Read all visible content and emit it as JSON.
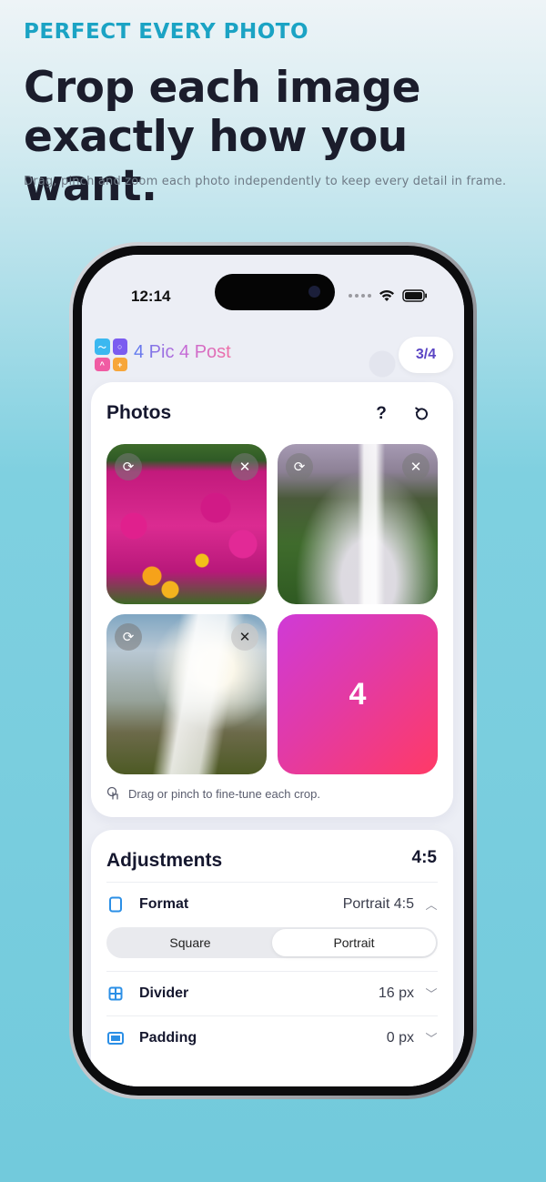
{
  "hero": {
    "eyebrow": "PERFECT EVERY PHOTO",
    "title_line1": "Crop each image",
    "title_line2": "exactly how you want.",
    "subtitle": "Drag, pinch and zoom each photo independently to keep every detail in frame."
  },
  "status_bar": {
    "time": "12:14",
    "icons": [
      "signal-dots-icon",
      "wifi-icon",
      "battery-icon"
    ]
  },
  "app_bar": {
    "app_name": "4 Pic 4 Post",
    "counter": "3/4"
  },
  "photos": {
    "title": "Photos",
    "help_icon_glyph": "?",
    "tiles": [
      {
        "kind": "photo",
        "subject": "flowers",
        "actions": [
          "rotate-icon",
          "remove-icon"
        ]
      },
      {
        "kind": "photo",
        "subject": "waterfall",
        "actions": [
          "rotate-icon",
          "remove-icon"
        ]
      },
      {
        "kind": "photo",
        "subject": "waterfall",
        "actions": [
          "rotate-icon",
          "remove-icon"
        ]
      },
      {
        "kind": "add",
        "label": "4"
      }
    ],
    "hint": "Drag or pinch to fine-tune each crop."
  },
  "adjustments": {
    "title": "Adjustments",
    "ratio": "4:5",
    "format": {
      "label": "Format",
      "value": "Portrait 4:5",
      "expanded": true
    },
    "segments": [
      "Square",
      "Portrait"
    ],
    "selected_segment": "Portrait",
    "divider": {
      "label": "Divider",
      "value": "16 px"
    },
    "padding": {
      "label": "Padding",
      "value": "0 px"
    }
  },
  "colors": {
    "accent_teal": "#1ba3c4",
    "brand_purple": "#5b45c4",
    "add_tile_gradient": [
      "#cf3ad7",
      "#ff3a66"
    ],
    "icon_blue": "#2b8fe6"
  }
}
